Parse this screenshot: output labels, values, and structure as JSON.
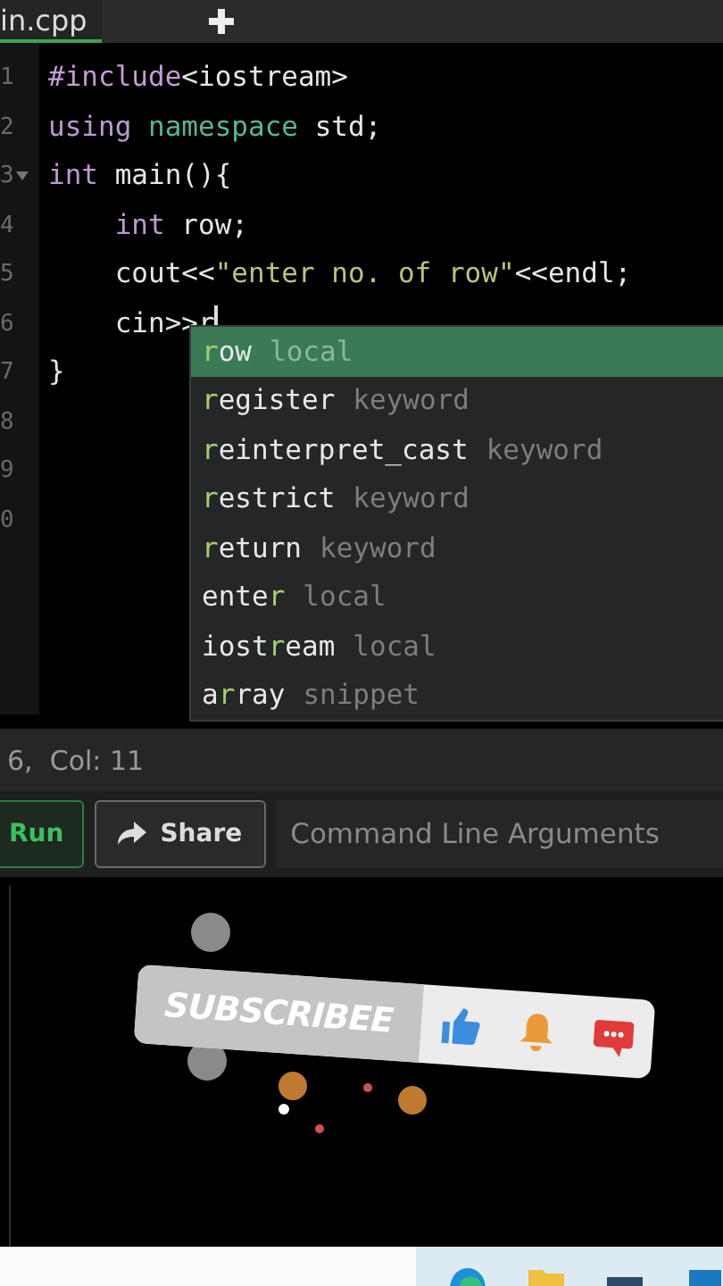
{
  "tabs": [
    {
      "label": "in.cpp",
      "selected": true
    }
  ],
  "editor": {
    "line_numbers": [
      {
        "text": "1",
        "foldable": false
      },
      {
        "text": "2",
        "foldable": false
      },
      {
        "text": "3",
        "foldable": true
      },
      {
        "text": "4",
        "foldable": false
      },
      {
        "text": "5",
        "foldable": false
      },
      {
        "text": "6",
        "foldable": false
      },
      {
        "text": "7",
        "foldable": false
      },
      {
        "text": "8",
        "foldable": false
      },
      {
        "text": "9",
        "foldable": false
      },
      {
        "text": "0",
        "foldable": false
      }
    ],
    "lines": [
      [
        {
          "text": "#include",
          "kind": "directive"
        },
        {
          "text": "<iostream>",
          "kind": "plain"
        }
      ],
      [
        {
          "text": "using ",
          "kind": "keyword"
        },
        {
          "text": "namespace ",
          "kind": "type"
        },
        {
          "text": "std;",
          "kind": "plain"
        }
      ],
      [
        {
          "text": "int ",
          "kind": "keyword"
        },
        {
          "text": "main(){",
          "kind": "plain"
        }
      ],
      [
        {
          "text": "    int ",
          "kind": "keyword"
        },
        {
          "text": "row;",
          "kind": "plain"
        }
      ],
      [
        {
          "text": "    cout<<",
          "kind": "plain"
        },
        {
          "text": "\"enter no. of row\"",
          "kind": "string"
        },
        {
          "text": "<<endl;",
          "kind": "plain"
        }
      ],
      [
        {
          "text": "    cin>>r",
          "kind": "plain",
          "cursor": true
        }
      ],
      [
        {
          "text": "}",
          "kind": "plain"
        }
      ]
    ],
    "autocomplete": [
      {
        "match": "r",
        "post": "ow",
        "type": "local",
        "selected": true
      },
      {
        "match": "r",
        "post": "egister",
        "type": "keyword",
        "selected": false
      },
      {
        "match": "r",
        "post": "einterpret_cast",
        "type": "keyword",
        "selected": false
      },
      {
        "match": "r",
        "post": "estrict",
        "type": "keyword",
        "selected": false
      },
      {
        "match": "r",
        "post": "eturn",
        "type": "keyword",
        "selected": false
      },
      {
        "pre": "ente",
        "match": "r",
        "type": "local",
        "selected": false
      },
      {
        "pre": "iost",
        "match": "r",
        "post": "eam",
        "type": "local",
        "selected": false
      },
      {
        "pre": "a",
        "match": "r",
        "post": "ray",
        "type": "snippet",
        "selected": false
      }
    ]
  },
  "status_bar": {
    "position": "6,  Col: 11"
  },
  "toolbar": {
    "run": "Run",
    "share": "Share",
    "arguments": {
      "placeholder": "Command Line Arguments"
    }
  },
  "overlay": {
    "label": "SUBSCRIBEE"
  }
}
